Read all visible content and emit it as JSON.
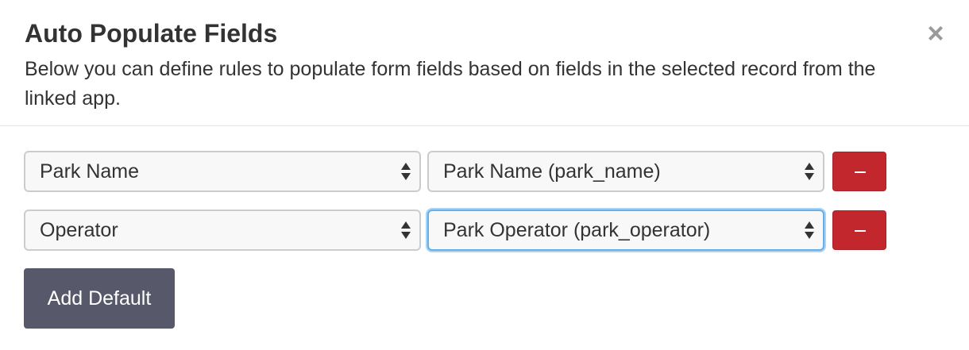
{
  "dialog": {
    "title": "Auto Populate Fields",
    "description": "Below you can define rules to populate form fields based on fields in the selected record from the linked app.",
    "close_label": "×"
  },
  "rules": [
    {
      "source_field": "Park Name",
      "target_field": "Park Name (park_name)",
      "remove_label": "−"
    },
    {
      "source_field": "Operator",
      "target_field": "Park Operator (park_operator)",
      "remove_label": "−"
    }
  ],
  "actions": {
    "add_default_label": "Add Default"
  },
  "colors": {
    "remove_button": "#c1272d",
    "add_default_button": "#575869",
    "focus_ring": "#66afe9"
  }
}
